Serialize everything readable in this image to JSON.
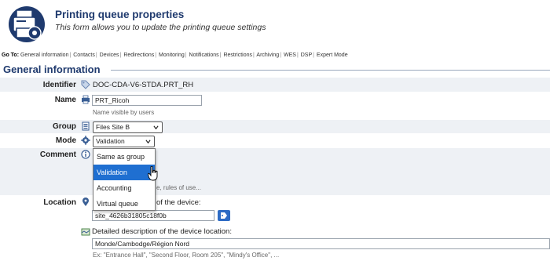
{
  "header": {
    "title": "Printing queue properties",
    "subtitle": "This form allows you to update the printing queue settings"
  },
  "goto": {
    "label": "Go To:",
    "links": [
      "General information",
      "Contacts",
      "Devices",
      "Redirections",
      "Monitoring",
      "Notifications",
      "Restrictions",
      "Archiving",
      "WES",
      "DSP",
      "Expert Mode"
    ]
  },
  "section": {
    "title": "General information"
  },
  "fields": {
    "identifier": {
      "label": "Identifier",
      "value": "DOC-CDA-V6-STDA.PRT_RH"
    },
    "name": {
      "label": "Name",
      "value": "PRT_Ricoh",
      "hint": "Name visible by users"
    },
    "group": {
      "label": "Group",
      "value": "Files Site B"
    },
    "mode": {
      "label": "Mode",
      "value": "Validation"
    },
    "comment": {
      "label": "Comment",
      "hint_partial": "e, rules of use..."
    },
    "location": {
      "label": "Location",
      "network_caption_partial": "of the device:",
      "network_value": "site_4626b31805c18f0b",
      "detail_caption": "Detailed description of the device location:",
      "detail_value": "Monde/Cambodge/Région Nord",
      "detail_hint": "Ex: \"Entrance Hall\", \"Second Floor, Room 205\", \"Mindy's Office\", ..."
    }
  },
  "mode_dropdown": {
    "options": [
      "Same as group",
      "Validation",
      "Accounting",
      "Virtual queue"
    ],
    "selected": "Validation"
  },
  "colors": {
    "accent": "#1f3a6e",
    "selection": "#1f6fd1",
    "row_shade": "#eef1f5"
  }
}
